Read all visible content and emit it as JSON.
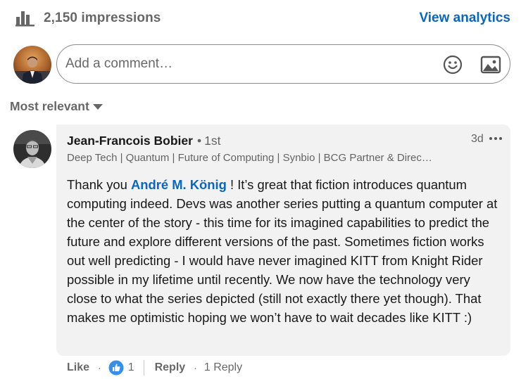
{
  "social_stats": {
    "impressions_text": "2,150 impressions",
    "analytics_link": "View analytics"
  },
  "comment_composer": {
    "placeholder": "Add a comment…"
  },
  "sort": {
    "label": "Most relevant"
  },
  "comment": {
    "author_name": "Jean-Francois Bobier",
    "separator": "•",
    "connection_degree": "1st",
    "headline": "Deep Tech | Quantum | Future of Computing | Synbio | BCG Partner & Direc…",
    "timestamp": "3d",
    "text_before_mention": "Thank you ",
    "mention": "André M. König",
    "text_after_mention": " ! It’s great that fiction introduces quantum computing indeed. Devs was another series putting a quantum computer at the center of the story - this time for its imagined capabilities to predict the future and explore different versions of the past. Sometimes fiction works out well predicting - I would have never imagined KITT from Knight Rider possible in my lifetime until recently. We now have the technology very close to what the series depicted (still not exactly there yet though). That makes me optimistic hoping we won’t have to wait decades like KITT :)"
  },
  "comment_actions": {
    "like_label": "Like",
    "like_count": "1",
    "reply_label": "Reply",
    "dot": "·",
    "replies_count": "1 Reply"
  },
  "icons": {
    "impressions": "bar-chart-icon",
    "emoji": "smiley-icon",
    "image": "image-icon",
    "sort_caret": "caret-down-icon",
    "more": "ellipsis-icon",
    "like_reaction": "thumbs-up-icon"
  },
  "colors": {
    "brand_link": "#0a66c2",
    "bubble_bg": "#f2f2f2",
    "muted_text": "rgba(0,0,0,0.6)"
  }
}
